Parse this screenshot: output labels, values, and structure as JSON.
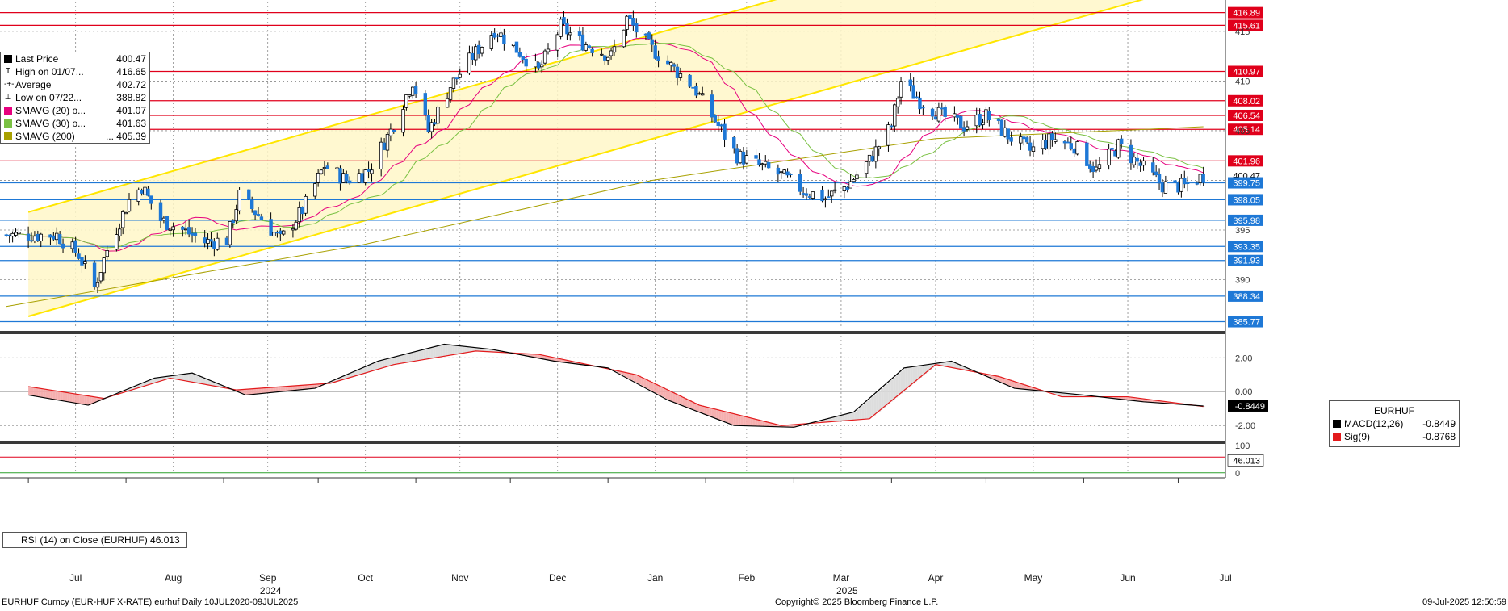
{
  "chart_data": [
    {
      "type": "candlestick",
      "title": "",
      "ylim": [
        385,
        418
      ],
      "y_ticks": [
        "390",
        "395",
        "405",
        "410",
        "415"
      ],
      "x_months": [
        "Jul",
        "Aug",
        "Sep",
        "Oct",
        "Nov",
        "Dec",
        "Jan",
        "Feb",
        "Mar",
        "Apr",
        "May",
        "Jun",
        "Jul"
      ],
      "x_years": [
        "2024",
        "2025"
      ],
      "legend": [
        {
          "label": "Last Price",
          "value": "400.47",
          "color": "#000000",
          "glyph": "box"
        },
        {
          "label": "High on 01/07...",
          "value": "416.65",
          "color": "#444444",
          "glyph": "T"
        },
        {
          "label": "Average",
          "value": "402.72",
          "color": "#444444",
          "glyph": "-+-"
        },
        {
          "label": "Low on 07/22...",
          "value": "388.82",
          "color": "#444444",
          "glyph": "⊥"
        },
        {
          "label": "SMAVG (20)   o...",
          "value": "401.07",
          "color": "#e6007e",
          "glyph": "box"
        },
        {
          "label": "SMAVG (30)   o...",
          "value": "401.63",
          "color": "#7ac143",
          "glyph": "box"
        },
        {
          "label": "SMAVG (200)",
          "value": "... 405.39",
          "color": "#a8a000",
          "glyph": "box"
        }
      ],
      "price_path": [
        [
          "2024-07-10",
          394.5
        ],
        [
          "2024-07-17",
          392.5
        ],
        [
          "2024-07-22",
          389.2
        ],
        [
          "2024-07-26",
          393.0
        ],
        [
          "2024-08-02",
          398.0
        ],
        [
          "2024-08-06",
          399.4
        ],
        [
          "2024-08-12",
          396.0
        ],
        [
          "2024-08-19",
          395.0
        ],
        [
          "2024-08-26",
          393.8
        ],
        [
          "2024-09-02",
          394.0
        ],
        [
          "2024-09-06",
          398.5
        ],
        [
          "2024-09-12",
          396.5
        ],
        [
          "2024-09-19",
          394.0
        ],
        [
          "2024-09-26",
          397.0
        ],
        [
          "2024-10-03",
          401.5
        ],
        [
          "2024-10-10",
          400.0
        ],
        [
          "2024-10-17",
          401.0
        ],
        [
          "2024-10-24",
          405.0
        ],
        [
          "2024-10-31",
          410.0
        ],
        [
          "2024-11-05",
          405.0
        ],
        [
          "2024-11-12",
          409.5
        ],
        [
          "2024-11-19",
          412.5
        ],
        [
          "2024-11-26",
          415.2
        ],
        [
          "2024-12-03",
          413.2
        ],
        [
          "2024-12-10",
          411.0
        ],
        [
          "2024-12-17",
          415.5
        ],
        [
          "2024-12-23",
          414.0
        ],
        [
          "2025-01-02",
          412.5
        ],
        [
          "2025-01-07",
          416.3
        ],
        [
          "2025-01-14",
          413.5
        ],
        [
          "2025-01-21",
          411.5
        ],
        [
          "2025-01-28",
          409.5
        ],
        [
          "2025-02-04",
          406.0
        ],
        [
          "2025-02-11",
          402.5
        ],
        [
          "2025-02-18",
          401.5
        ],
        [
          "2025-02-25",
          400.5
        ],
        [
          "2025-03-04",
          399.0
        ],
        [
          "2025-03-11",
          398.2
        ],
        [
          "2025-03-18",
          399.5
        ],
        [
          "2025-03-25",
          402.0
        ],
        [
          "2025-04-01",
          405.5
        ],
        [
          "2025-04-04",
          410.0
        ],
        [
          "2025-04-10",
          408.0
        ],
        [
          "2025-04-17",
          406.5
        ],
        [
          "2025-04-24",
          405.5
        ],
        [
          "2025-05-01",
          406.5
        ],
        [
          "2025-05-08",
          404.5
        ],
        [
          "2025-05-15",
          403.0
        ],
        [
          "2025-05-22",
          404.2
        ],
        [
          "2025-05-29",
          403.5
        ],
        [
          "2025-06-05",
          401.0
        ],
        [
          "2025-06-12",
          403.5
        ],
        [
          "2025-06-19",
          401.5
        ],
        [
          "2025-06-26",
          399.5
        ],
        [
          "2025-07-03",
          399.4
        ],
        [
          "2025-07-09",
          400.47
        ]
      ],
      "horizontal_lines": {
        "red": [
          {
            "value": 416.89,
            "label": "416.89"
          },
          {
            "value": 415.61,
            "label": "415.61"
          },
          {
            "value": 410.97,
            "label": "410.97"
          },
          {
            "value": 408.02,
            "label": "408.02"
          },
          {
            "value": 406.54,
            "label": "406.54"
          },
          {
            "value": 405.14,
            "label": "405.14"
          },
          {
            "value": 401.96,
            "label": "401.96"
          }
        ],
        "blue": [
          {
            "value": 399.75,
            "label": "399.75"
          },
          {
            "value": 398.05,
            "label": "398.05"
          },
          {
            "value": 395.98,
            "label": "395.98"
          },
          {
            "value": 393.35,
            "label": "393.35"
          },
          {
            "value": 391.93,
            "label": "391.93"
          },
          {
            "value": 388.34,
            "label": "388.34"
          },
          {
            "value": 385.77,
            "label": "385.77"
          }
        ],
        "last_price_label": "400.47"
      },
      "channel": {
        "lower_line": [
          [
            "2024-07-01",
            386.3
          ],
          [
            "2025-07-15",
            420.5
          ]
        ],
        "upper_line": [
          [
            "2024-07-01",
            396.8
          ],
          [
            "2025-07-15",
            431.0
          ]
        ],
        "color": "#ffe600"
      }
    },
    {
      "type": "line",
      "legend_title": "EURHUF",
      "ylim": [
        -2.8,
        3.3
      ],
      "y_ticks": [
        "2.00",
        "0.00",
        "-2.00"
      ],
      "series": [
        {
          "name": "MACD(12,26)",
          "value": "-0.8449",
          "color": "#000000",
          "points": [
            [
              "2024-07-01",
              -0.2
            ],
            [
              "2024-07-20",
              -0.8
            ],
            [
              "2024-08-10",
              0.8
            ],
            [
              "2024-08-22",
              1.1
            ],
            [
              "2024-09-08",
              -0.2
            ],
            [
              "2024-09-30",
              0.2
            ],
            [
              "2024-10-20",
              1.8
            ],
            [
              "2024-11-10",
              2.8
            ],
            [
              "2024-11-25",
              2.5
            ],
            [
              "2024-12-15",
              1.8
            ],
            [
              "2025-01-01",
              1.4
            ],
            [
              "2025-01-20",
              -0.5
            ],
            [
              "2025-02-10",
              -2.0
            ],
            [
              "2025-03-01",
              -2.1
            ],
            [
              "2025-03-20",
              -1.2
            ],
            [
              "2025-04-05",
              1.4
            ],
            [
              "2025-04-20",
              1.8
            ],
            [
              "2025-05-10",
              0.2
            ],
            [
              "2025-06-01",
              -0.2
            ],
            [
              "2025-06-20",
              -0.6
            ],
            [
              "2025-07-09",
              -0.8449
            ]
          ]
        },
        {
          "name": "Sig(9)",
          "value": "-0.8768",
          "color": "#e31a1c",
          "points": [
            [
              "2024-07-01",
              0.3
            ],
            [
              "2024-07-25",
              -0.4
            ],
            [
              "2024-08-15",
              0.8
            ],
            [
              "2024-09-05",
              0.1
            ],
            [
              "2024-10-05",
              0.5
            ],
            [
              "2024-10-25",
              1.6
            ],
            [
              "2024-11-20",
              2.4
            ],
            [
              "2024-12-10",
              2.2
            ],
            [
              "2025-01-10",
              1.0
            ],
            [
              "2025-01-30",
              -0.8
            ],
            [
              "2025-02-25",
              -2.0
            ],
            [
              "2025-03-25",
              -1.6
            ],
            [
              "2025-04-15",
              1.6
            ],
            [
              "2025-05-05",
              0.9
            ],
            [
              "2025-05-25",
              -0.3
            ],
            [
              "2025-06-15",
              -0.3
            ],
            [
              "2025-07-09",
              -0.8768
            ]
          ]
        }
      ],
      "last_value_label": "-0.8449"
    },
    {
      "type": "line",
      "legend": "RSI (14)   on Close (EURHUF) 46.013",
      "ylim": [
        0,
        100
      ],
      "y_ticks": [
        "100",
        "0"
      ],
      "last_value_label": "46.013"
    }
  ],
  "footer": {
    "left": "EURHUF Curncy (EUR-HUF X-RATE) eurhuf  Daily 10JUL2020-09JUL2025",
    "center": "Copyright© 2025 Bloomberg Finance L.P.",
    "right": "09-Jul-2025 12:50:59"
  }
}
